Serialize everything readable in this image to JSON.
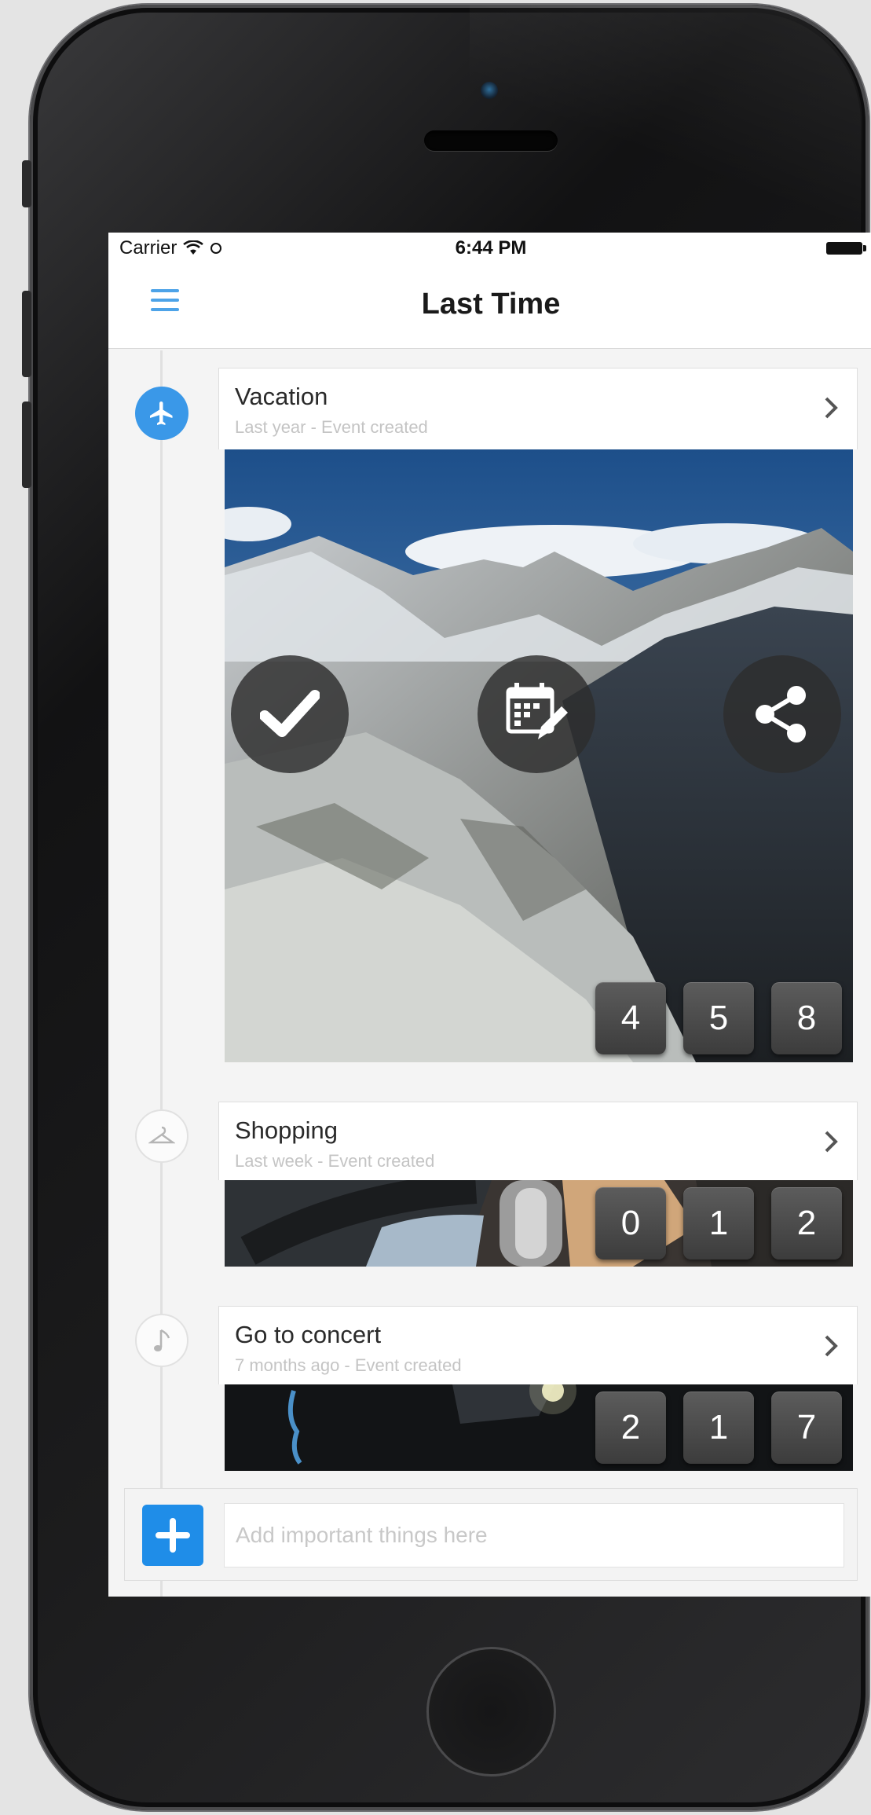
{
  "status_bar": {
    "carrier": "Carrier",
    "time": "6:44 PM"
  },
  "nav": {
    "title": "Last Time",
    "menu_icon": "hamburger-menu-icon"
  },
  "events": [
    {
      "title": "Vacation",
      "subtitle": "Last year - Event created",
      "icon": "airplane-icon",
      "active": true,
      "actions": [
        "checkmark-icon",
        "calendar-edit-icon",
        "share-icon"
      ],
      "counters": [
        "4",
        "5",
        "8"
      ]
    },
    {
      "title": "Shopping",
      "subtitle": "Last week - Event created",
      "icon": "hanger-icon",
      "active": false,
      "counters": [
        "0",
        "1",
        "2"
      ]
    },
    {
      "title": "Go to concert",
      "subtitle": "7 months ago - Event created",
      "icon": "music-note-icon",
      "active": false,
      "counters": [
        "2",
        "1",
        "7"
      ]
    }
  ],
  "add_bar": {
    "placeholder": "Add important things here",
    "button_icon": "plus-icon"
  },
  "colors": {
    "accent": "#1f8de8",
    "timeline_active": "#3a98e8"
  }
}
